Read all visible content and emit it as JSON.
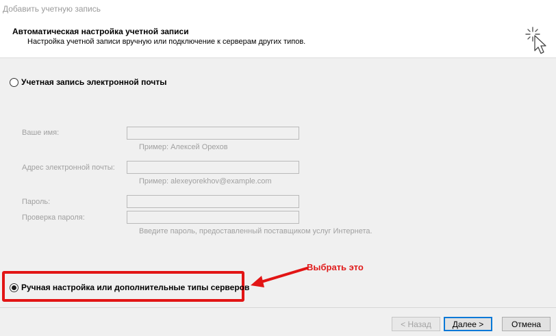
{
  "window": {
    "title": "Добавить учетную запись"
  },
  "header": {
    "title": "Автоматическая настройка учетной записи",
    "subtitle": "Настройка учетной записи вручную или подключение к серверам других типов."
  },
  "options": {
    "email_account": {
      "label": "Учетная запись электронной почты",
      "checked": false
    },
    "manual_setup": {
      "label": "Ручная настройка или дополнительные типы серверов",
      "checked": true
    }
  },
  "form": {
    "name": {
      "label": "Ваше имя:",
      "value": "",
      "hint": "Пример: Алексей Орехов"
    },
    "email": {
      "label": "Адрес электронной почты:",
      "value": "",
      "hint": "Пример: alexeyorekhov@example.com"
    },
    "password": {
      "label": "Пароль:",
      "value": ""
    },
    "password_confirm": {
      "label": "Проверка пароля:",
      "value": "",
      "hint": "Введите пароль, предоставленный поставщиком услуг Интернета."
    }
  },
  "annotation": {
    "text": "Выбрать это",
    "color": "#e01b1b"
  },
  "buttons": {
    "back": "< Назад",
    "next": "Далее >",
    "cancel": "Отмена"
  },
  "colors": {
    "accent": "#0078d7",
    "highlight": "#e21515",
    "disabled_text": "#a0a0a0"
  }
}
